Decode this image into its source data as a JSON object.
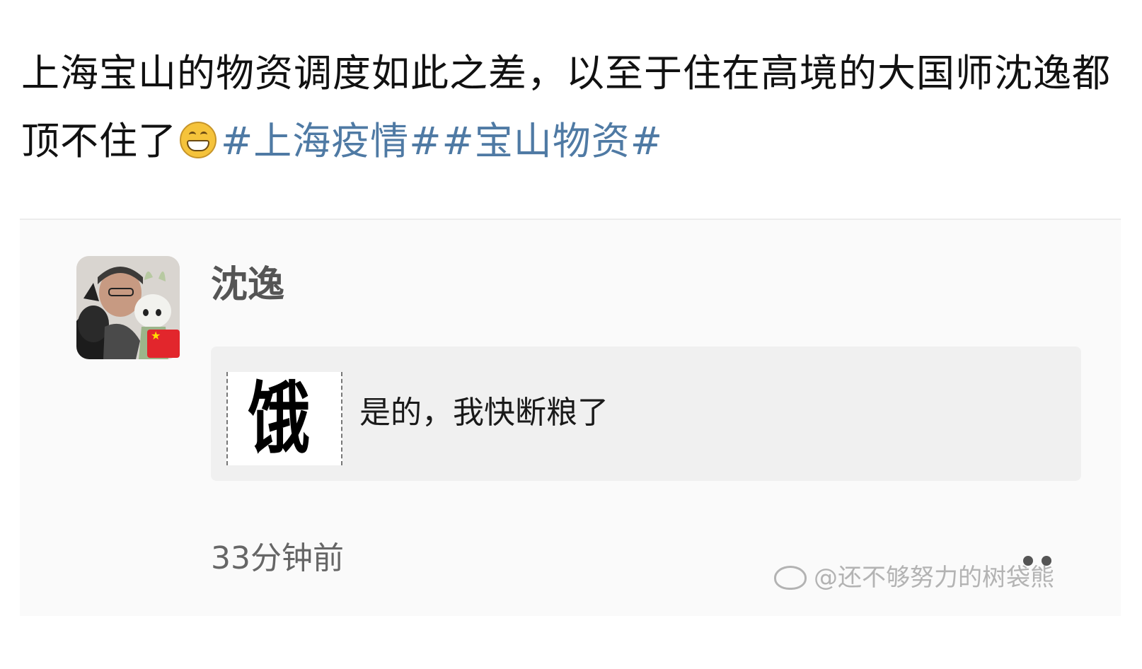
{
  "post": {
    "text": "上海宝山的物资调度如此之差，以至于住在高境的大国师沈逸都顶不住了",
    "emoji": "grinning-face-icon",
    "topics": [
      "#上海疫情#",
      "#宝山物资#"
    ],
    "topic_color": "#4f7aa4"
  },
  "comment": {
    "username": "沈逸",
    "avatar": "avatar-photo-with-plush-toy",
    "badge": "china-flag-icon",
    "sticker_text": "饿",
    "reply_text": "是的，我快断粮了",
    "timestamp": "33分钟前",
    "more": "more-options-icon"
  },
  "watermark": {
    "logo": "weibo-logo-icon",
    "text": "@还不够努力的树袋熊"
  }
}
